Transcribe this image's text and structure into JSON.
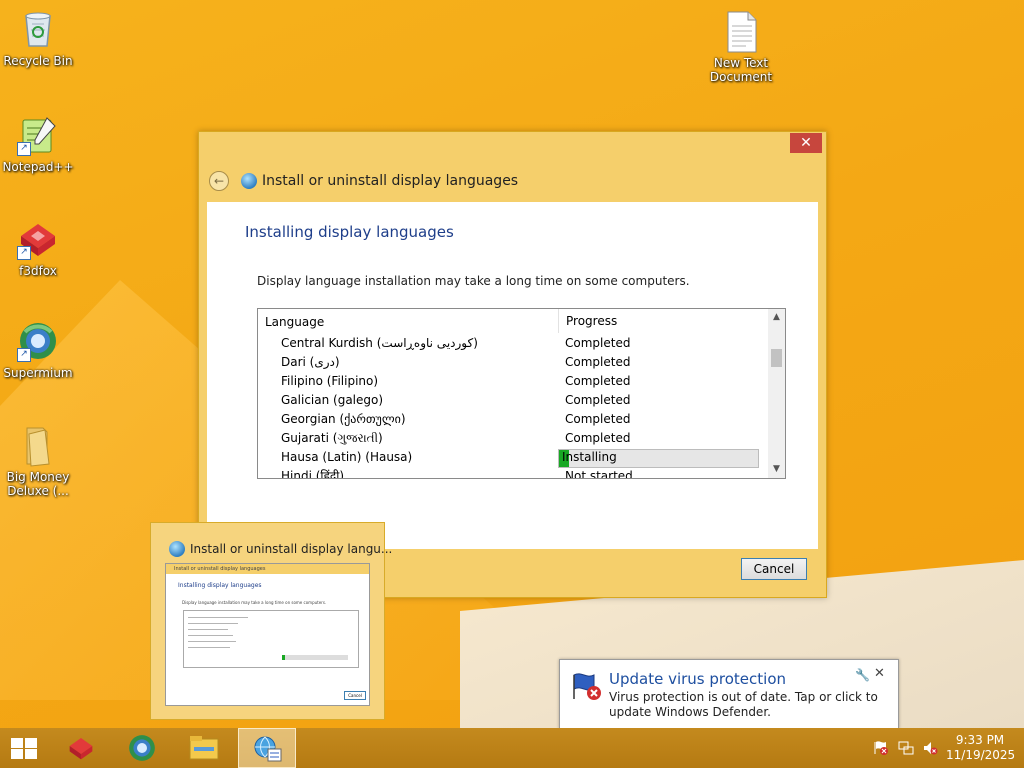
{
  "desktop": {
    "icons": [
      {
        "label": "Recycle Bin",
        "icon": "recycle-bin-icon"
      },
      {
        "label": "Notepad++",
        "icon": "notepad-plus-plus-icon"
      },
      {
        "label": "f3dfox",
        "icon": "f3dfox-icon"
      },
      {
        "label": "Supermium",
        "icon": "supermium-icon"
      },
      {
        "label": "Big Money Deluxe (...",
        "icon": "folder-icon"
      },
      {
        "label": "New Text Document",
        "icon": "text-document-icon"
      }
    ]
  },
  "dialog": {
    "title": "Install or uninstall display languages",
    "close_label": "✕",
    "heading": "Installing display languages",
    "description": "Display language installation may take a long time on some computers.",
    "columns": [
      "Language",
      "Progress"
    ],
    "rows": [
      {
        "language": "Central Kurdish (کوردیی ناوەڕاست)",
        "progress": "Completed"
      },
      {
        "language": "Dari (دری)",
        "progress": "Completed"
      },
      {
        "language": "Filipino (Filipino)",
        "progress": "Completed"
      },
      {
        "language": "Galician (galego)",
        "progress": "Completed"
      },
      {
        "language": "Georgian (ქართული)",
        "progress": "Completed"
      },
      {
        "language": "Gujarati (ગુજરાતી)",
        "progress": "Completed"
      },
      {
        "language": "Hausa (Latin) (Hausa)",
        "progress": "Installing",
        "progress_fraction": 0.05
      },
      {
        "language": "Hindi (हिंदी)",
        "progress": "Not started"
      }
    ],
    "cancel_label": "Cancel"
  },
  "thumbnail": {
    "title": "Install or uninstall display langu...",
    "mini_top": "Install or uninstall display languages",
    "mini_heading": "Installing display languages",
    "mini_desc": "Display language installation may take a long time on some computers.",
    "mini_cancel": "Cancel"
  },
  "toast": {
    "title": "Update virus protection",
    "body": "Virus protection is out of date. Tap or click to update Windows Defender.",
    "close_label": "✕"
  },
  "taskbar": {
    "time": "9:33 PM",
    "date": "11/19/2025",
    "items": [
      "start-button",
      "f3dfox-taskbar",
      "supermium-taskbar",
      "file-explorer-taskbar",
      "language-settings-taskbar"
    ]
  },
  "colors": {
    "accent_heading": "#1e3e8a",
    "progress_green": "#19a824",
    "close_red": "#c7463d",
    "desktop_orange": "#f4a815"
  }
}
